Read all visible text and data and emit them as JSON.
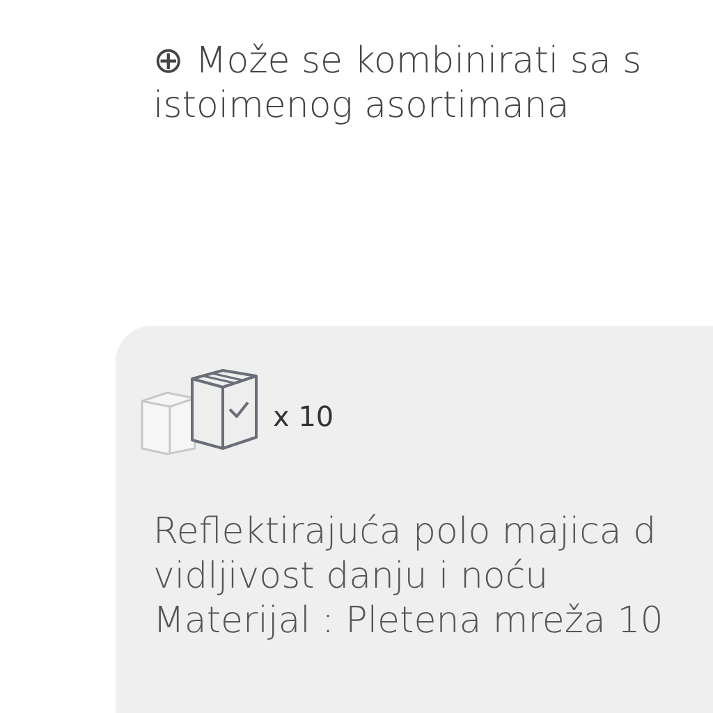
{
  "note": {
    "lines": [
      "⊕ Može se kombinirati sa s",
      "istoimenog asortimana"
    ]
  },
  "card": {
    "quantity": "x 10",
    "description_lines": [
      "Reflektirajuća polo majica d",
      "vidljivost danju i noću",
      "Materijal : Pletena mreža 10"
    ]
  }
}
